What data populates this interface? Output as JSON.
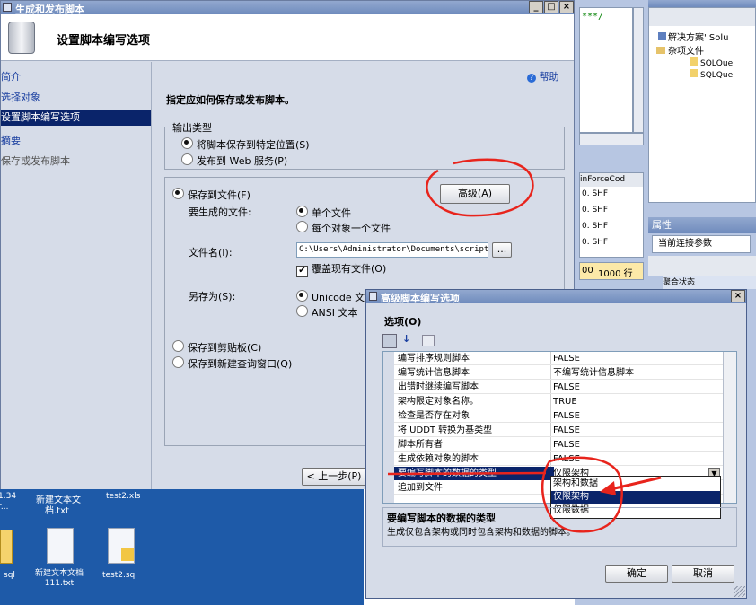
{
  "main_window": {
    "title": "生成和发布脚本",
    "header": "设置脚本编写选项",
    "help": "帮助",
    "nav": [
      "简介",
      "选择对象",
      "设置脚本编写选项",
      "摘要",
      "保存或发布脚本"
    ],
    "instruction": "指定应如何保存或发布脚本。",
    "output_type_label": "输出类型",
    "opt_save_location": "将脚本保存到特定位置(S)",
    "opt_publish_web": "发布到 Web 服务(P)",
    "opt_save_file": "保存到文件(F)",
    "advanced_button": "高级(A)",
    "files_to_generate_label": "要生成的文件:",
    "opt_single_file": "单个文件",
    "opt_file_per_object": "每个对象一个文件",
    "filename_label": "文件名(I):",
    "filename_value": "C:\\Users\\Administrator\\Documents\\script",
    "browse_button": "...",
    "overwrite_label": "覆盖现有文件(O)",
    "save_as_label": "另存为(S):",
    "opt_unicode": "Unicode 文本",
    "opt_ansi": "ANSI 文本",
    "opt_clipboard": "保存到剪贴板(C)",
    "opt_new_query": "保存到新建查询窗口(Q)",
    "prev_button": "< 上一步(P)"
  },
  "bg_ide": {
    "code_snip": "***/",
    "grid_header": "inForceCod",
    "grid_cells": [
      "0. SHF",
      "0. SHF",
      "0. SHF",
      "0. SHF"
    ],
    "status": [
      "00",
      "1000 行"
    ],
    "panel_title": "解决方",
    "solution_label": "解决方案' Solu",
    "misc_files": "杂项文件",
    "file1": "SQLQue",
    "file2": "SQLQue",
    "props_title": "属性",
    "props_dropdown": "当前连接参数",
    "props_item": "聚合状态"
  },
  "desktop": {
    "row1": [
      "1.34",
      "新建文本文",
      "test2.xls"
    ],
    "row1b": [
      "r...",
      "档.txt",
      ""
    ],
    "icons": [
      {
        "label": "sql"
      },
      {
        "label": "新建文本文档\n111.txt"
      },
      {
        "label": "test2.sql"
      }
    ]
  },
  "adv_dialog": {
    "title": "高级脚本编写选项",
    "options_label": "选项(O)",
    "rows": [
      {
        "name": "编写排序规则脚本",
        "value": "FALSE"
      },
      {
        "name": "编写统计信息脚本",
        "value": "不编写统计信息脚本"
      },
      {
        "name": "出错时继续编写脚本",
        "value": "FALSE"
      },
      {
        "name": "架构限定对象名称。",
        "value": "TRUE"
      },
      {
        "name": "检查是否存在对象",
        "value": "FALSE"
      },
      {
        "name": "将 UDDT 转换为基类型",
        "value": "FALSE"
      },
      {
        "name": "脚本所有者",
        "value": "FALSE"
      },
      {
        "name": "生成依赖对象的脚本",
        "value": "FALSE"
      },
      {
        "name": "要编写脚本的数据的类型",
        "value": "仅限架构"
      },
      {
        "name": "追加到文件",
        "value": ""
      }
    ],
    "dropdown_options": [
      "架构和数据",
      "仅限架构",
      "仅限数据"
    ],
    "desc_title": "要编写脚本的数据的类型",
    "desc_text": "生成仅包含架构或同时包含架构和数据的脚本。",
    "ok": "确定",
    "cancel": "取消"
  },
  "colors": {
    "accent": "#0a246a",
    "annotation": "#e8241c",
    "title_bar": "#7e97c6"
  }
}
